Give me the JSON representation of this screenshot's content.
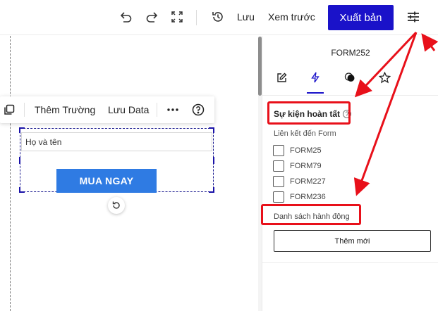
{
  "topbar": {
    "undo_icon": "undo-icon",
    "redo_icon": "redo-icon",
    "fullscreen_icon": "fullscreen-icon",
    "history_icon": "history-icon",
    "save_label": "Lưu",
    "preview_label": "Xem trước",
    "publish_label": "Xuất bản",
    "settings_icon": "sliders-icon"
  },
  "element_toolbar": {
    "duplicate_icon": "duplicate-icon",
    "add_field_label": "Thêm Trường",
    "save_data_label": "Lưu Data",
    "more_icon": "more-icon",
    "help_icon": "help-icon"
  },
  "form": {
    "name_placeholder": "Họ và tên",
    "buy_button_label": "MUA NGAY"
  },
  "panel": {
    "title": "FORM252",
    "tabs": [
      {
        "icon": "edit-icon"
      },
      {
        "icon": "lightning-icon",
        "active": true
      },
      {
        "icon": "contrast-icon"
      },
      {
        "icon": "star-icon"
      }
    ],
    "event_section_title": "Sự kiện hoàn tất",
    "link_form_label": "Liên kết đến Form",
    "linked_forms": [
      {
        "label": "FORM25",
        "checked": false
      },
      {
        "label": "FORM79",
        "checked": false
      },
      {
        "label": "FORM227",
        "checked": false
      },
      {
        "label": "FORM236",
        "checked": false
      }
    ],
    "actions_label": "Danh sách hành động",
    "add_new_label": "Thêm mới"
  },
  "colors": {
    "accent": "#1a12c9",
    "buy_button": "#2f7be3",
    "annotation": "#e8101a"
  }
}
